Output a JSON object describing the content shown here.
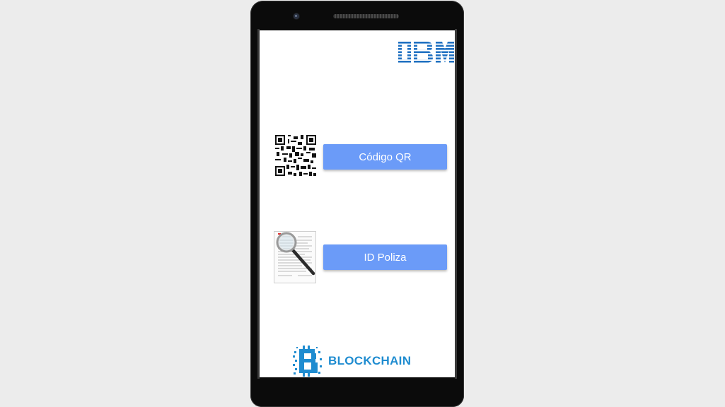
{
  "brand": {
    "ibm_logo_text": "IBM",
    "blockchain_text": "BLOCKCHAIN"
  },
  "actions": {
    "qr_button_label": "Código QR",
    "policy_button_label": "ID Poliza"
  },
  "icons": {
    "qr": "qr-code-icon",
    "document": "document-magnifier-icon",
    "blockchain": "blockchain-b-icon"
  },
  "colors": {
    "button": "#6b9bf8",
    "ibm_blue": "#1f70c1",
    "blockchain_blue": "#1f8cd0"
  }
}
